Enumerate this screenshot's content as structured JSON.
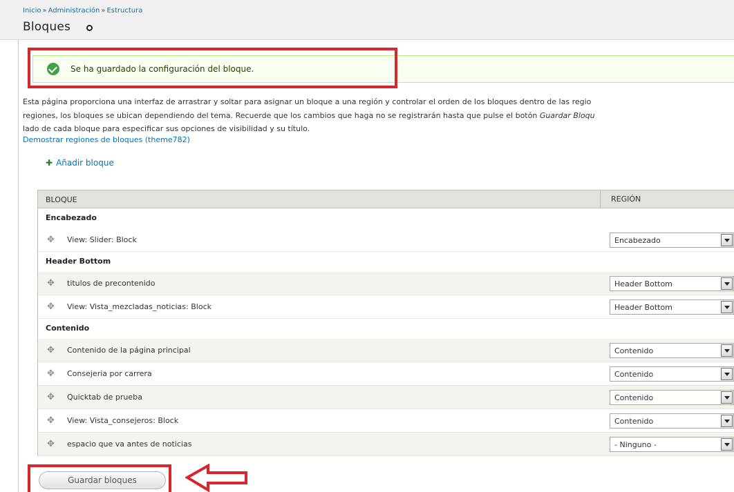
{
  "breadcrumb": {
    "items": [
      "Inicio",
      "Administración",
      "Estructura"
    ],
    "separator": "»"
  },
  "page_title": "Bloques",
  "status_message": "Se ha guardado la configuración del bloque.",
  "help": {
    "line1": "Esta página proporciona una interfaz de arrastrar y soltar para asignar un bloque a una región y controlar el orden de los bloques dentro de las regio",
    "line2_lead": "regiones, los bloques se ubican dependiendo del tema. Recuerde que los cambios que haga no se registrarán hasta que pulse el botón ",
    "line2_em": "Guardar Bloqu",
    "line3": "lado de cada bloque para especificar sus opciones de visibilidad y su título."
  },
  "demo_link": "Demostrar regiones de bloques (theme782)",
  "add_block": {
    "icon": "plus-icon",
    "label": "Añadir bloque"
  },
  "table": {
    "headers": {
      "block": "BLOQUE",
      "region": "REGIÓN"
    },
    "regions": [
      {
        "label": "Encabezado",
        "blocks": [
          {
            "name": "View: Slider: Block",
            "region": "Encabezado"
          }
        ]
      },
      {
        "label": "Header Bottom",
        "blocks": [
          {
            "name": "titulos de precontenido",
            "region": "Header Bottom"
          },
          {
            "name": "View: Vista_mezcladas_noticias: Block",
            "region": "Header Bottom"
          }
        ]
      },
      {
        "label": "Contenido",
        "blocks": [
          {
            "name": "Contenido de la página principal",
            "region": "Contenido"
          },
          {
            "name": "Consejeria por carrera",
            "region": "Contenido"
          },
          {
            "name": "Quicktab de prueba",
            "region": "Contenido"
          },
          {
            "name": "View: Vista_consejeros: Block",
            "region": "Contenido"
          },
          {
            "name": "espacio que va antes de noticias",
            "region": "- Ninguno -"
          }
        ]
      }
    ]
  },
  "save_button": "Guardar bloques",
  "colors": {
    "link": "#0074bd",
    "annotation": "#d8262d",
    "status_bg": "#f8fff0",
    "status_icon": "#43a047"
  }
}
